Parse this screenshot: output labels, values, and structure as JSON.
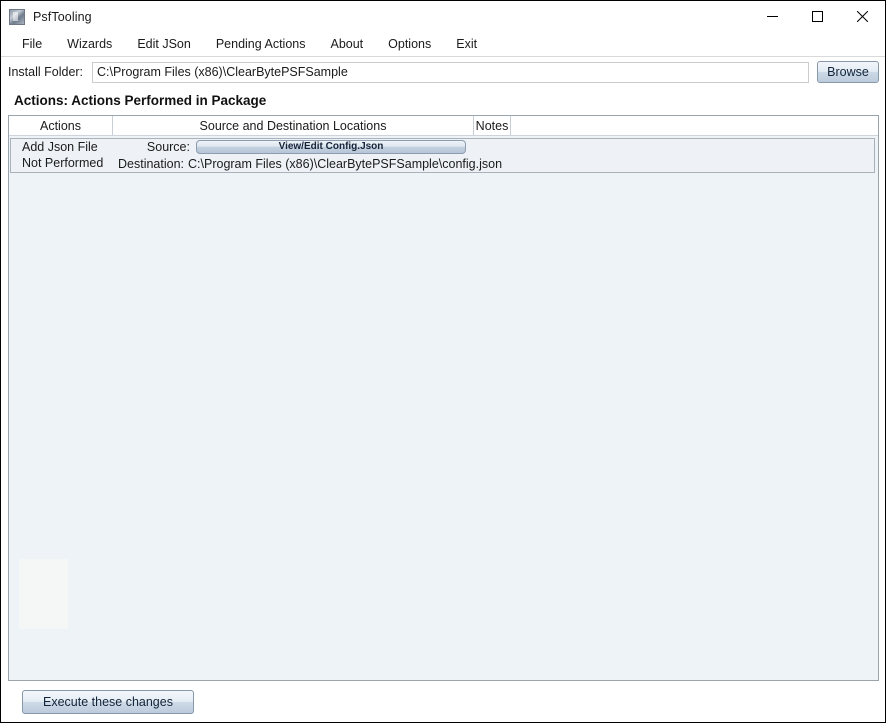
{
  "window": {
    "title": "PsfTooling",
    "icon": "app-icon",
    "controls": {
      "minimize": "minimize-icon",
      "maximize": "maximize-icon",
      "close": "close-icon"
    }
  },
  "menubar": {
    "items": [
      {
        "label": "File"
      },
      {
        "label": "Wizards"
      },
      {
        "label": "Edit JSon"
      },
      {
        "label": "Pending Actions"
      },
      {
        "label": "About"
      },
      {
        "label": "Options"
      },
      {
        "label": "Exit"
      }
    ]
  },
  "install": {
    "label": "Install Folder:",
    "value": "C:\\Program Files (x86)\\ClearBytePSFSample",
    "placeholder": "",
    "browse_label": "Browse"
  },
  "section": {
    "heading": "Actions: Actions Performed in Package"
  },
  "table": {
    "columns": [
      {
        "label": "Actions"
      },
      {
        "label": "Source and Destination Locations"
      },
      {
        "label": "Notes"
      }
    ],
    "rows": [
      {
        "action_name": "Add Json File",
        "action_status": "Not Performed",
        "source_label": "Source:",
        "source_button_label": "View/Edit Config.Json",
        "destination_label": "Destination:",
        "destination_value": "C:\\Program Files (x86)\\ClearBytePSFSample\\config.json",
        "notes": ""
      }
    ]
  },
  "footer": {
    "execute_label": "Execute these changes"
  },
  "colors": {
    "window_border": "#000000",
    "panel_background": "#eef3f7",
    "row_background": "#eef2f6",
    "row_border": "#a9b2bb",
    "button_accent": "#bccbdc",
    "text": "#1b1b1b"
  }
}
